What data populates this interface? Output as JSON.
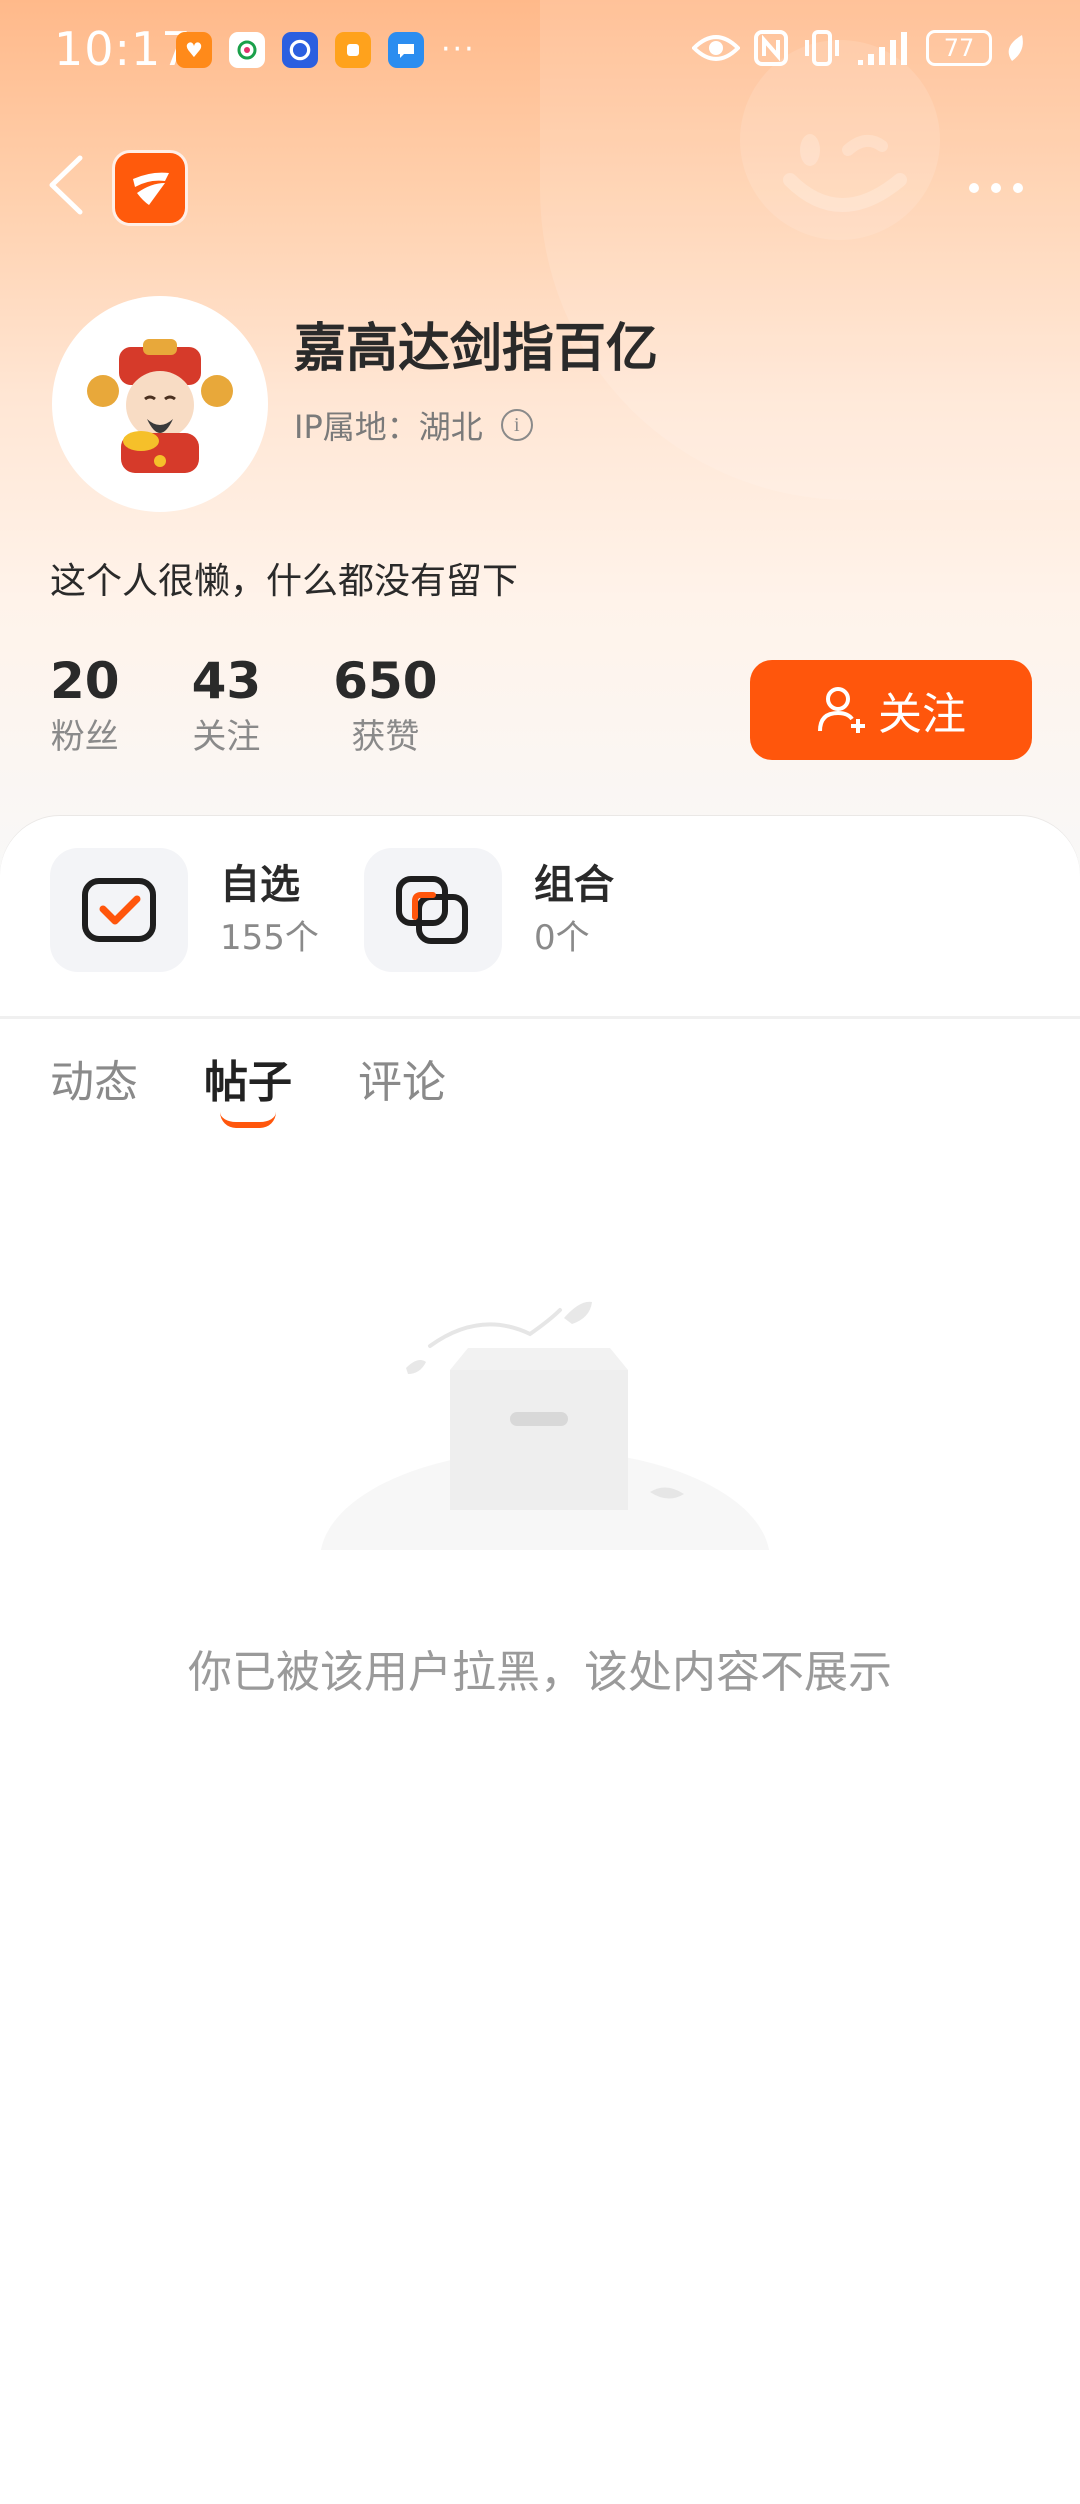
{
  "status_bar": {
    "time": "10:17",
    "notification_icons": [
      "app-icon-orange",
      "app-icon-green",
      "app-icon-blue-ring",
      "app-icon-orange-square",
      "app-icon-blue-chat"
    ],
    "more_notifications": "···",
    "system_icons": [
      "eye-icon",
      "nfc-icon",
      "vibrate-icon",
      "signal-icon"
    ],
    "battery": "77"
  },
  "nav": {
    "back_icon": "back-arrow-icon",
    "logo_icon": "app-logo-icon",
    "more_icon": "more-icon"
  },
  "profile": {
    "name": "嘉高达剑指百亿",
    "ip_location": "IP属地：湖北",
    "bio": "这个人很懒，什么都没有留下",
    "stats": [
      {
        "value": "20",
        "label": "粉丝"
      },
      {
        "value": "43",
        "label": "关注"
      },
      {
        "value": "650",
        "label": "获赞"
      }
    ],
    "follow_button": "关注"
  },
  "entries": [
    {
      "title": "自选",
      "count": "155个"
    },
    {
      "title": "组合",
      "count": "0个"
    }
  ],
  "tabs": [
    {
      "label": "动态",
      "active": false
    },
    {
      "label": "帖子",
      "active": true
    },
    {
      "label": "评论",
      "active": false
    }
  ],
  "empty_state": {
    "message": "你已被该用户拉黑，该处内容不展示"
  },
  "colors": {
    "accent": "#ff560c",
    "header_gradient_top": "#ffb98a",
    "text_primary": "#2a2a2a",
    "text_secondary": "#8a8a8a"
  }
}
